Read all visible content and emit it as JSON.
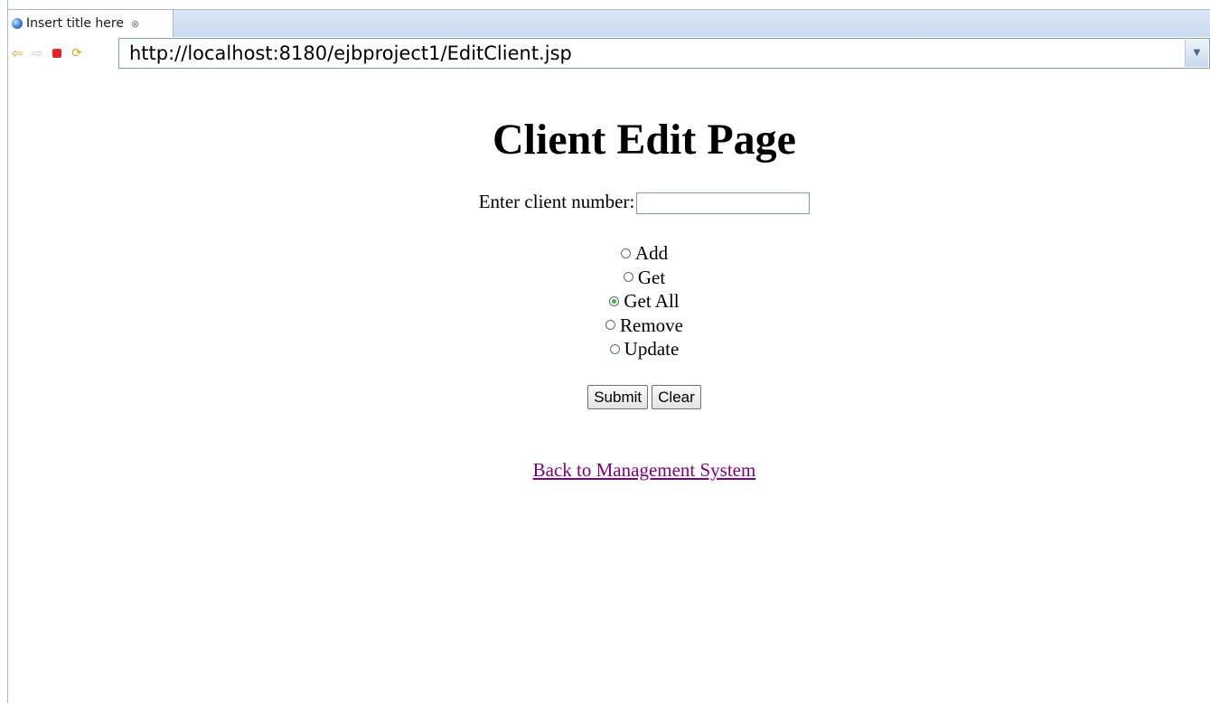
{
  "tab": {
    "title": "Insert title here",
    "close_glyph": "⊗",
    "icon": "globe-icon"
  },
  "navbar": {
    "back_icon": "back-arrow-icon",
    "forward_icon": "forward-arrow-icon",
    "stop_icon": "stop-icon",
    "refresh_icon": "refresh-icon",
    "url": "http://localhost:8180/ejbproject1/EditClient.jsp",
    "dropdown_icon": "chevron-down-icon"
  },
  "page": {
    "title": "Client Edit Page",
    "client_label": "Enter client number:",
    "client_value": "",
    "radios": [
      {
        "label": "Add",
        "checked": false
      },
      {
        "label": "Get",
        "checked": false
      },
      {
        "label": "Get All",
        "checked": true
      },
      {
        "label": "Remove",
        "checked": false
      },
      {
        "label": "Update",
        "checked": false
      }
    ],
    "submit_label": "Submit",
    "clear_label": "Clear",
    "back_link_label": "Back to Management System"
  },
  "colors": {
    "link_visited": "#800080",
    "radio_checked": "#3cb843",
    "tabstrip": "#c9daf1"
  }
}
